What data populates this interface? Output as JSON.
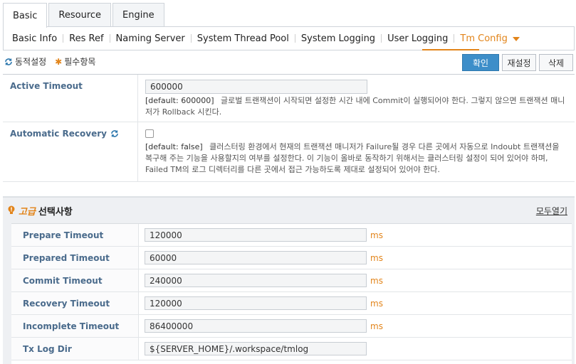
{
  "top_tabs": [
    "Basic",
    "Resource",
    "Engine"
  ],
  "sub_tabs": [
    "Basic Info",
    "Res Ref",
    "Naming Server",
    "System Thread Pool",
    "System Logging",
    "User Logging",
    "Tm Config"
  ],
  "legend": {
    "dynamic": "동적설정",
    "required": "필수항목"
  },
  "buttons": {
    "confirm": "확인",
    "reset": "재설정",
    "delete": "삭제"
  },
  "active_timeout": {
    "label": "Active Timeout",
    "value": "600000",
    "default": "[default: 600000]",
    "desc": "글로벌 트랜잭션이 시작되면 설정한 시간 내에 Commit이 실행되어야 한다. 그렇지 않으면 트랜잭션 매니저가 Rollback 시킨다."
  },
  "automatic_recovery": {
    "label": "Automatic Recovery",
    "default": "[default: false]",
    "desc": "클러스터링 환경에서 현재의 트랜잭션 매니저가 Failure될 경우 다른 곳에서 자동으로 Indoubt 트랜잭션을 복구해 주는 기능을 사용할지의 여부를 설정한다. 이 기능이 올바로 동작하기 위해서는 클러스터링 설정이 되어 있어야 하며, Failed TM의 로그 디렉터리를 다른 곳에서 접근 가능하도록 제대로 설정되어 있어야 한다."
  },
  "advanced": {
    "title_em": "고급",
    "title": "선택사항",
    "expand_all": "모두열기",
    "rows": [
      {
        "label": "Prepare Timeout",
        "value": "120000",
        "unit": "ms"
      },
      {
        "label": "Prepared Timeout",
        "value": "60000",
        "unit": "ms"
      },
      {
        "label": "Commit Timeout",
        "value": "240000",
        "unit": "ms"
      },
      {
        "label": "Recovery Timeout",
        "value": "120000",
        "unit": "ms"
      },
      {
        "label": "Incomplete Timeout",
        "value": "86400000",
        "unit": "ms"
      },
      {
        "label": "Tx Log Dir",
        "value": "${SERVER_HOME}/.workspace/tmlog",
        "unit": ""
      }
    ]
  },
  "colors": {
    "accent": "#e2841a",
    "primary": "#3d8ec9",
    "label": "#4a6b8c"
  }
}
